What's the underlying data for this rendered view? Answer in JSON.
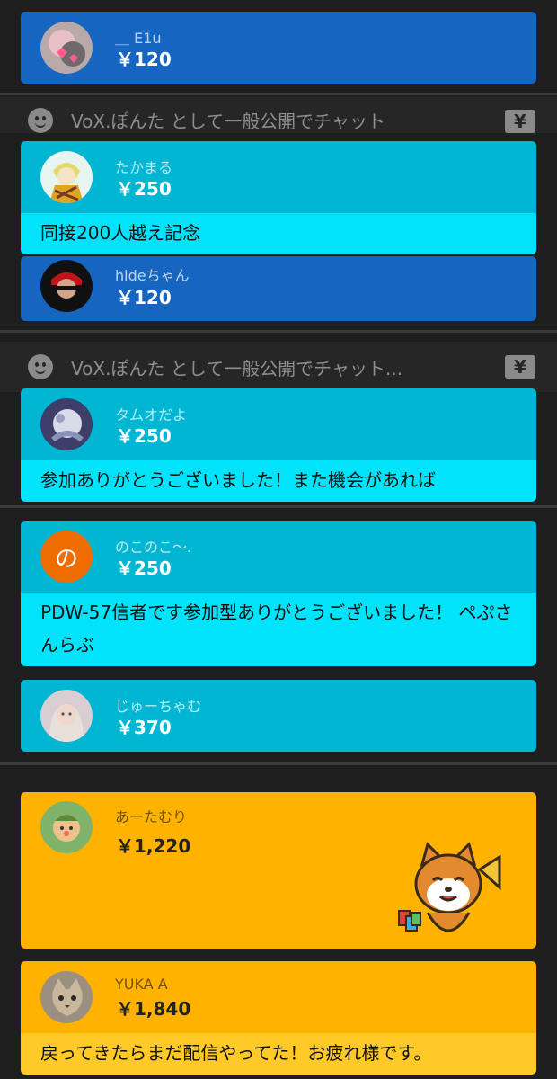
{
  "chat_input": {
    "placeholder": "VoX.ぽんた として一般公開でチャット...",
    "placeholder_partial": "VoX.ぽんた として一般公開でチャット",
    "currency_button": "¥"
  },
  "superchats": [
    {
      "name": "＿ E1u",
      "amount": "￥120",
      "message": "",
      "color": "#1665c1",
      "icon": "avatar-photo"
    },
    {
      "name": "たかまる",
      "amount": "￥250",
      "message": "同接200人越え記念",
      "color": "#00b6d3",
      "icon": "avatar-anime"
    },
    {
      "name": "hideちゃん",
      "amount": "￥120",
      "message": "",
      "color": "#1665c1",
      "icon": "avatar-photo"
    },
    {
      "name": "タムオだよ",
      "amount": "￥250",
      "message": "参加ありがとうございました！また機会があれば",
      "color": "#00b6d3",
      "icon": "avatar-photo"
    },
    {
      "name": "のこのこ〜.",
      "amount": "￥250",
      "message": "PDW-57信者です参加型ありがとうございました！ ぺぷさんらぶ",
      "color": "#00b6d3",
      "avatar_letter": "の"
    },
    {
      "name": "じゅーちゃむ",
      "amount": "￥370",
      "message": "",
      "color": "#00b6d3",
      "icon": "avatar-photo"
    },
    {
      "name": "あーたむり",
      "amount": "￥1,220",
      "message": "",
      "color": "#ffb300",
      "icon": "avatar-photo",
      "sticker": "shiba-dog-megaphone-sticker"
    },
    {
      "name": "YUKA A",
      "amount": "￥1,840",
      "message": "戻ってきたらまだ配信やってた！お疲れ様です。",
      "color": "#ffb300",
      "icon": "avatar-cat-photo"
    }
  ]
}
